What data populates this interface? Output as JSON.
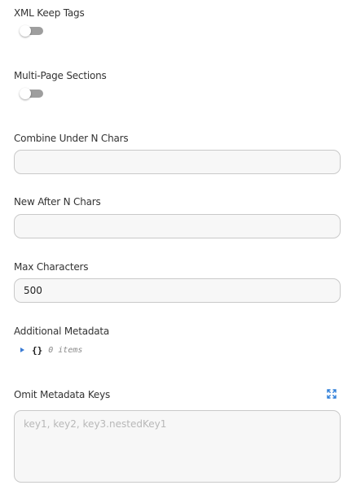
{
  "fields": {
    "xml_keep_tags": {
      "label": "XML Keep Tags",
      "enabled": false
    },
    "multi_page_sections": {
      "label": "Multi-Page Sections",
      "enabled": false
    },
    "combine_under_n_chars": {
      "label": "Combine Under N Chars",
      "value": ""
    },
    "new_after_n_chars": {
      "label": "New After N Chars",
      "value": ""
    },
    "max_characters": {
      "label": "Max Characters",
      "value": "500"
    },
    "additional_metadata": {
      "label": "Additional Metadata",
      "braces": "{}",
      "count_text": "0 items",
      "icon": "caret-right-icon"
    },
    "omit_metadata_keys": {
      "label": "Omit Metadata Keys",
      "placeholder": "key1, key2, key3.nestedKey1",
      "expand_icon": "expand-icon"
    }
  },
  "colors": {
    "toggle_off_track": "#9e9e9e",
    "caret": "#3a7bd5",
    "expand_icon": "#2f7fd9",
    "input_border": "#c9c9c9",
    "input_bg": "#f7f7f7"
  }
}
